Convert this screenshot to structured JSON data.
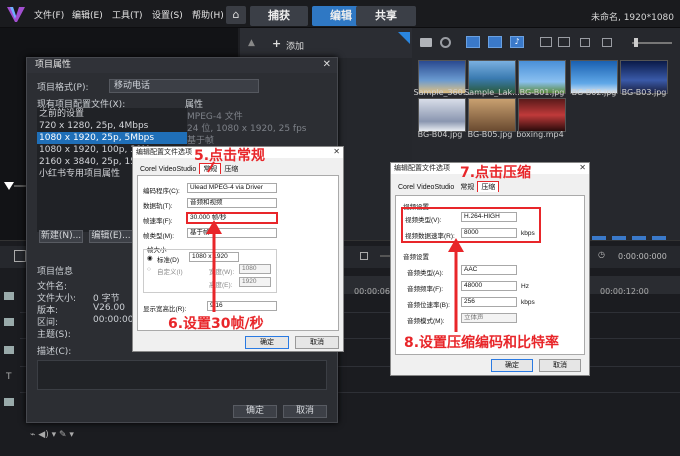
{
  "app": {
    "menu": [
      "文件(F)",
      "编辑(E)",
      "工具(T)",
      "设置(S)",
      "帮助(H)"
    ],
    "tabs": [
      "捕获",
      "编辑",
      "共享"
    ],
    "active_tab": "编辑",
    "project_title": "未命名, 1920*1080",
    "add_label": "添加"
  },
  "library": {
    "items": [
      {
        "name": "Sample_360...",
        "color": "#3a6fb0"
      },
      {
        "name": "Sample_Lak...",
        "color": "#4a8ac0"
      },
      {
        "name": "BG-B01.jpg",
        "color": "#5aa0d8"
      },
      {
        "name": "BG-B02.jpg",
        "color": "#2c6fb8"
      },
      {
        "name": "BG-B03.jpg",
        "color": "#1a3a78"
      },
      {
        "name": "BG-B04.jpg",
        "color": "#c0c8d8"
      },
      {
        "name": "BG-B05.jpg",
        "color": "#8a6a4a"
      },
      {
        "name": "boxing.mp4",
        "color": "#b03030"
      }
    ]
  },
  "timeline": {
    "timecode1": "0:00:00:000",
    "timecode2": "00:00:06:00",
    "timecode3": "00:00:12:00",
    "zoom_pct": 0.3
  },
  "project_dialog": {
    "title": "项目属性",
    "format_label": "项目格式(P):",
    "format_value": "移动电话",
    "profiles_label": "现有项目配置文件(X):",
    "props_label": "属性",
    "profiles": [
      "之前的设置",
      "720 x 1280, 25p, 4Mbps",
      "1080 x 1920, 25p, 5Mbps",
      "1080 x 1920, 100p, 30M",
      "2160 x 3840, 25p, 15Mb",
      "小红书专用项目属性"
    ],
    "selected_profile": 2,
    "properties": [
      "MPEG-4 文件",
      "24 位, 1080 x 1920, 25 fps",
      "基于帧"
    ],
    "btn_new": "新建(N)...",
    "btn_edit": "编辑(E)...",
    "info_label": "项目信息",
    "info": [
      {
        "k": "文件名:",
        "v": ""
      },
      {
        "k": "文件大小:",
        "v": "0 字节"
      },
      {
        "k": "版本:",
        "v": "V26.00"
      },
      {
        "k": "区间:",
        "v": "00:00:00:0"
      },
      {
        "k": "主题(S):",
        "v": ""
      },
      {
        "k": "描述(C):",
        "v": ""
      }
    ],
    "btn_ok": "确定",
    "btn_cancel": "取消"
  },
  "general_dialog": {
    "title": "编辑配置文件选项",
    "tabs": [
      "Corel VideoStudio",
      "常规",
      "压缩"
    ],
    "active_tab": "常规",
    "encoder_label": "编码程序(C):",
    "encoder_value": "Ulead MPEG-4 via Driver",
    "data_track_label": "数据轨(T):",
    "data_track_value": "音频和视频",
    "frame_rate_label": "帧速率(F):",
    "frame_rate_value": "30.000 帧/秒",
    "frame_type_label": "帧类型(M):",
    "frame_type_value": "基于帧",
    "frame_size_label": "帧大小",
    "standard_label": "标准(D)",
    "standard_value": "1080 x 1920",
    "custom_label": "自定义(I)",
    "width_label": "宽度(W):",
    "width_value": "1080",
    "height_label": "高度(E):",
    "height_value": "1920",
    "aspect_label": "显示宽高比(R):",
    "aspect_value": "9:16",
    "ok": "确定",
    "cancel": "取消"
  },
  "compress_dialog": {
    "title": "编辑配置文件选项",
    "tabs": [
      "Corel VideoStudio",
      "常规",
      "压缩"
    ],
    "active_tab": "压缩",
    "video_group": "视频设置",
    "video_type_label": "视频类型(V):",
    "video_type_value": "H.264-HIGH",
    "video_bitrate_label": "视频数据速率(R):",
    "video_bitrate_value": "8000",
    "video_bitrate_unit": "kbps",
    "audio_group": "音频设置",
    "audio_type_label": "音频类型(A):",
    "audio_type_value": "AAC",
    "audio_rate_label": "音频频率(F):",
    "audio_rate_value": "48000",
    "audio_rate_unit": "Hz",
    "audio_bitrate_label": "音频位速率(B):",
    "audio_bitrate_value": "256",
    "audio_bitrate_unit": "kbps",
    "audio_mode_label": "音频模式(M):",
    "audio_mode_value": "立体声",
    "ok": "确定",
    "cancel": "取消"
  },
  "annotations": {
    "step5": "5.点击常规",
    "step6": "6.设置30帧/秒",
    "step7": "7.点击压缩",
    "step8": "8.设置压缩编码和比特率",
    "color": "#e8262a"
  }
}
